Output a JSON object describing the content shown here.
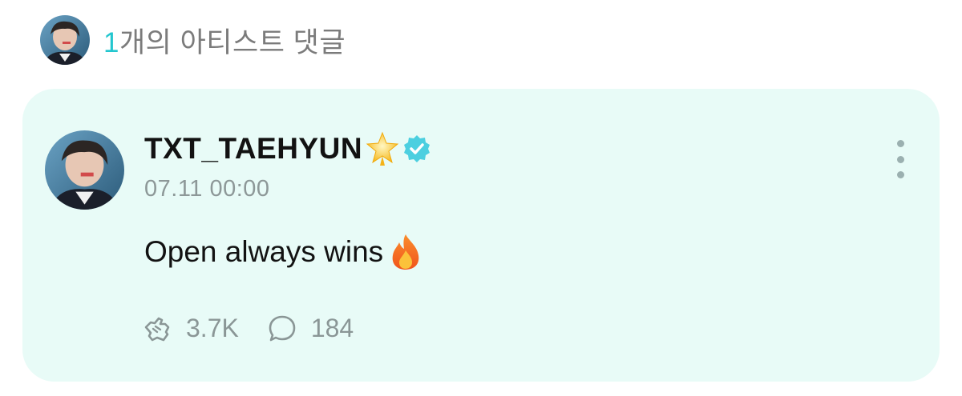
{
  "header": {
    "count": "1",
    "title": "개의 아티스트 댓글",
    "avatar_icon": "artist-avatar"
  },
  "comment": {
    "username": "TXT_TAEHYUN",
    "badge_icon": "star-icon",
    "verified_icon": "verified-icon",
    "timestamp": "07.11 00:00",
    "text": "Open always wins",
    "emoji_icon": "fire-icon",
    "more_icon": "more-vertical-icon",
    "like_icon": "like-hands-icon",
    "like_count": "3.7K",
    "reply_icon": "speech-bubble-icon",
    "reply_count": "184"
  },
  "colors": {
    "accent": "#23c6cf",
    "card_background": "#e8fbf7",
    "verified": "#4ccfe0",
    "muted_text": "#8d9898"
  }
}
